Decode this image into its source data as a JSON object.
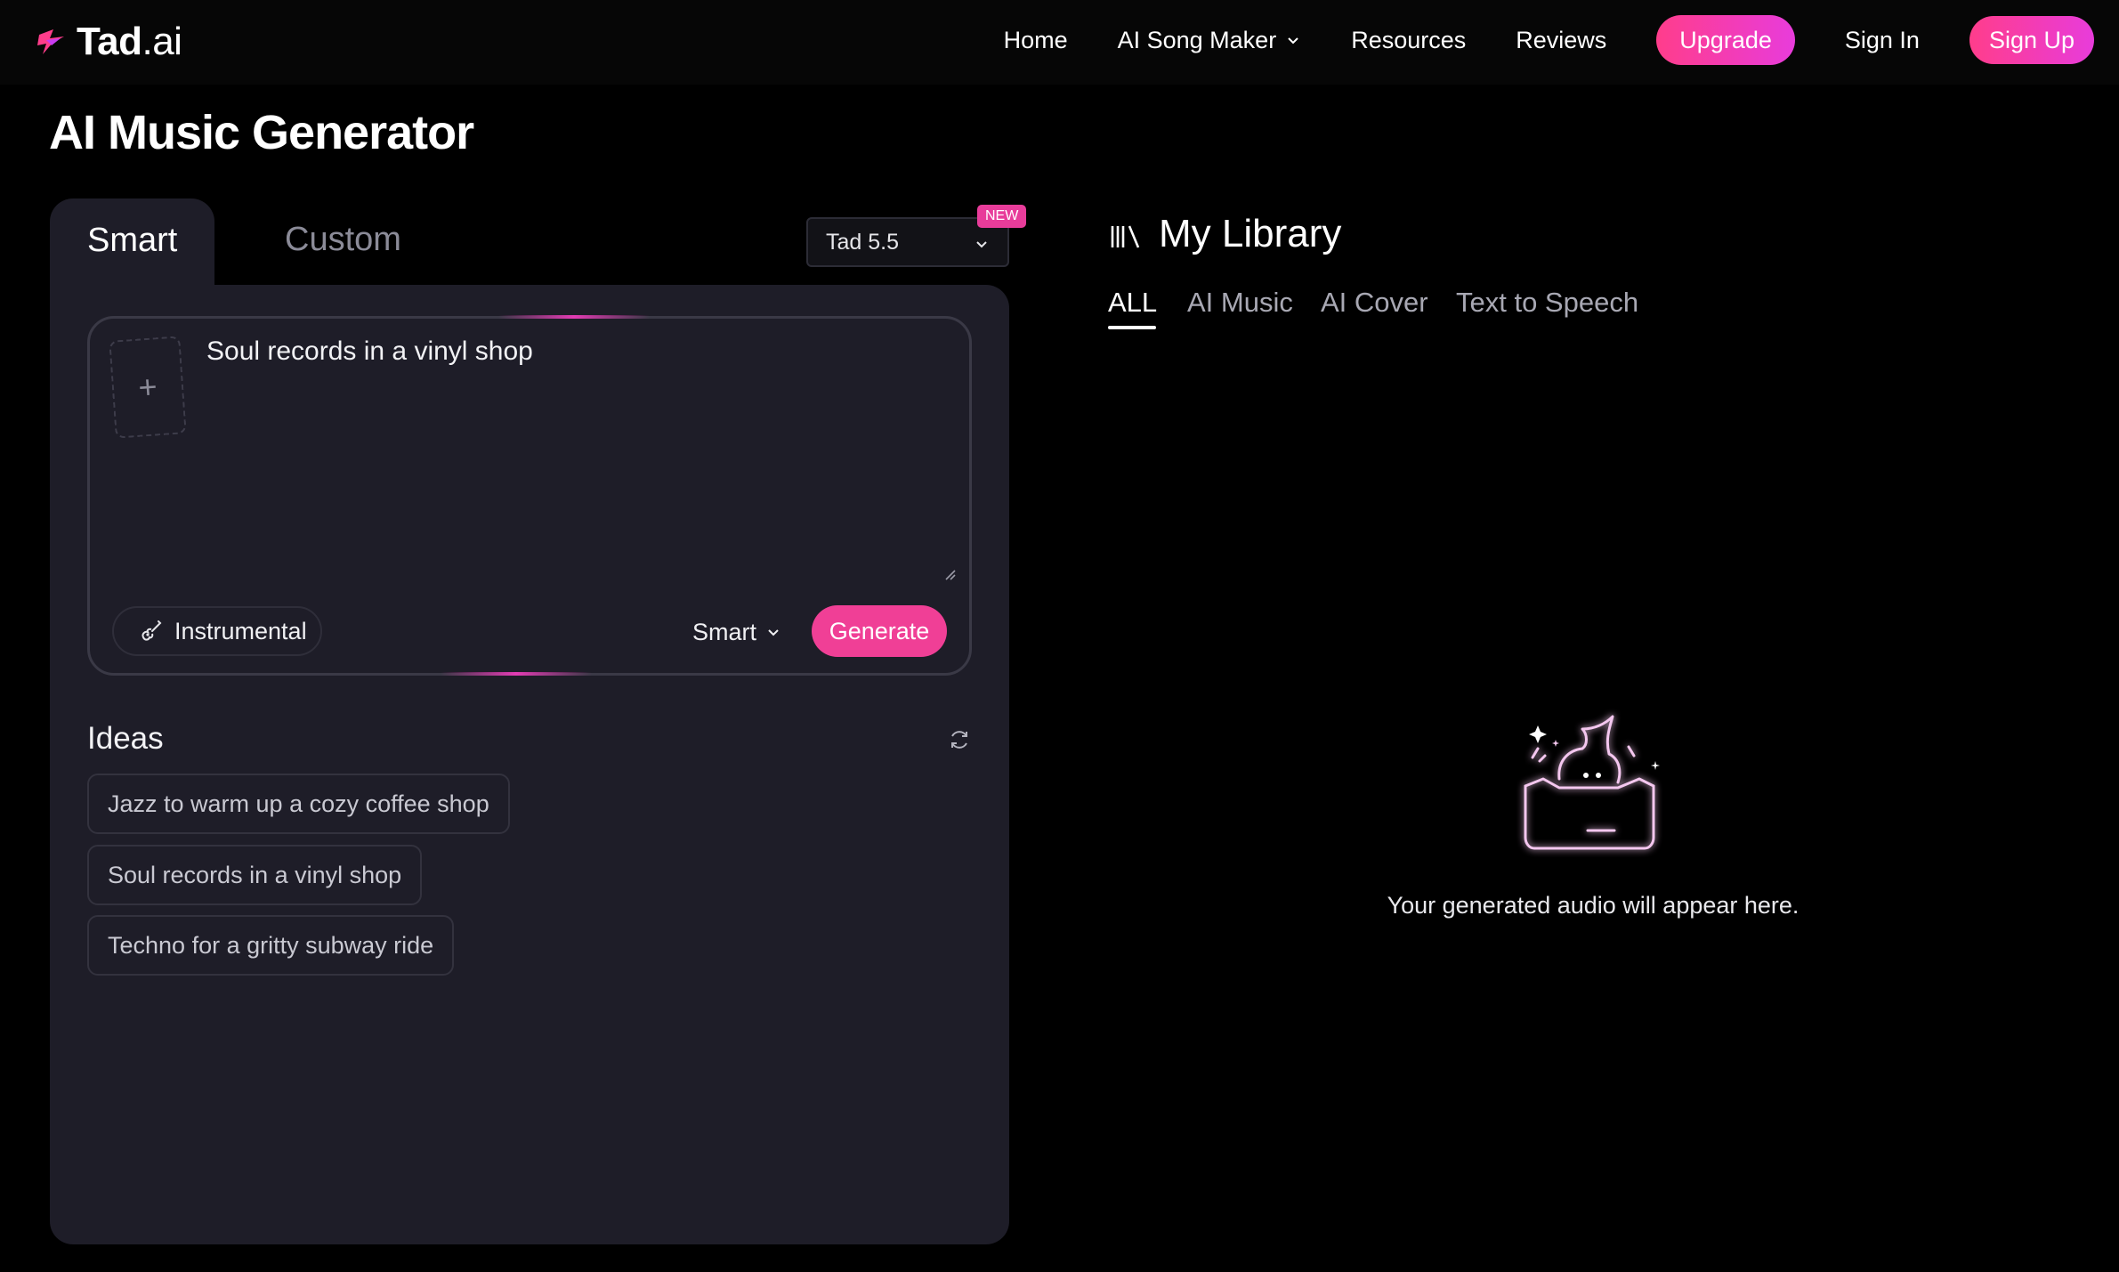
{
  "brand": {
    "name_bold": "Tad",
    "name_light": ".ai"
  },
  "nav": {
    "home": "Home",
    "song_maker": "AI Song Maker",
    "resources": "Resources",
    "reviews": "Reviews",
    "upgrade": "Upgrade",
    "sign_in": "Sign In",
    "sign_up": "Sign Up"
  },
  "page": {
    "title": "AI Music Generator"
  },
  "generator": {
    "tabs": {
      "smart": "Smart",
      "custom": "Custom",
      "active": "Smart"
    },
    "model": {
      "selected": "Tad 5.5",
      "badge": "NEW"
    },
    "upload_icon": "+",
    "prompt_value": "Soul records in a vinyl shop",
    "instrumental_label": "Instrumental",
    "mode_selected": "Smart",
    "generate_label": "Generate"
  },
  "ideas": {
    "title": "Ideas",
    "items": [
      "Jazz to warm up a cozy coffee shop",
      "Soul records in a vinyl shop",
      "Techno for a gritty subway ride"
    ]
  },
  "library": {
    "title": "My Library",
    "tabs": [
      "ALL",
      "AI Music",
      "AI Cover",
      "Text to Speech"
    ],
    "active_tab": "ALL",
    "empty_message": "Your generated audio will appear here."
  },
  "colors": {
    "accent_pink": "#f03f96",
    "gradient_start": "#ff3d8b",
    "gradient_end": "#e83cdb",
    "panel_bg": "#1e1d28",
    "page_bg": "#000000"
  }
}
